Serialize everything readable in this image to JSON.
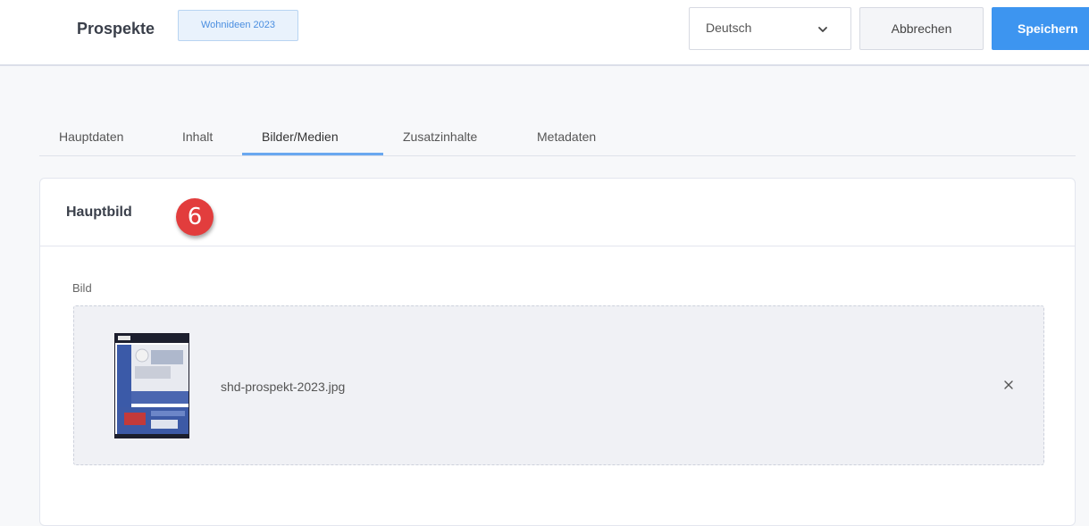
{
  "header": {
    "title": "Prospekte",
    "badge": "Wohnideen 2023",
    "language": {
      "selected": "Deutsch"
    },
    "cancel_label": "Abbrechen",
    "save_label": "Speichern"
  },
  "tabs": [
    {
      "label": "Hauptdaten",
      "active": false
    },
    {
      "label": "Inhalt",
      "active": false
    },
    {
      "label": "Bilder/Medien",
      "active": true
    },
    {
      "label": "Zusatzinhalte",
      "active": false
    },
    {
      "label": "Metadaten",
      "active": false
    }
  ],
  "card": {
    "title": "Hauptbild",
    "step_number": "6",
    "field_label": "Bild",
    "file": {
      "name": "shd-prospekt-2023.jpg"
    },
    "remove_icon": "close-icon"
  },
  "colors": {
    "accent": "#3d95f0",
    "step_badge": "#e23d3d",
    "badge_text": "#4a8ee0"
  }
}
